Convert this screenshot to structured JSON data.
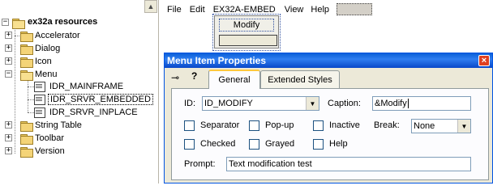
{
  "tree": {
    "root_label": "ex32a resources",
    "items": [
      {
        "label": "Accelerator",
        "expander": "+"
      },
      {
        "label": "Dialog",
        "expander": "+"
      },
      {
        "label": "Icon",
        "expander": "+"
      },
      {
        "label": "Menu",
        "expander": "−"
      },
      {
        "label": "IDR_MAINFRAME"
      },
      {
        "label": "IDR_SRVR_EMBEDDED"
      },
      {
        "label": "IDR_SRVR_INPLACE"
      },
      {
        "label": "String Table",
        "expander": "+"
      },
      {
        "label": "Toolbar",
        "expander": "+"
      },
      {
        "label": "Version",
        "expander": "+"
      }
    ]
  },
  "menubar": {
    "file": "File",
    "edit": "Edit",
    "embed": "EX32A-EMBED",
    "view": "View",
    "help": "Help"
  },
  "popup": {
    "modify": "Modify"
  },
  "dialog": {
    "title": "Menu Item Properties",
    "close": "×",
    "pin": "⊸",
    "help": "?",
    "tabs": [
      "General",
      "Extended Styles"
    ],
    "id_label": "ID:",
    "id_value": "ID_MODIFY",
    "caption_label": "Caption:",
    "caption_value": "&Modify",
    "checkboxes": [
      "Separator",
      "Pop-up",
      "Inactive",
      "Checked",
      "Grayed",
      "Help"
    ],
    "break_label": "Break:",
    "break_value": "None",
    "prompt_label": "Prompt:",
    "prompt_value": "Text modification test"
  }
}
